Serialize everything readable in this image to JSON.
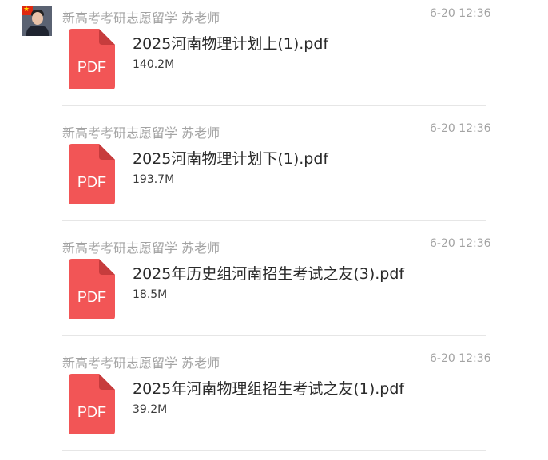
{
  "colors": {
    "pdf_icon": "#f25556",
    "pdf_icon_fold": "#c73c3d",
    "meta_text": "#a3a3a3",
    "divider": "#e6e6e6"
  },
  "avatar_icon": "user-avatar-with-china-flag",
  "messages": [
    {
      "sender": "新高考考研志愿留学 苏老师",
      "time": "6-20 12:36",
      "file_icon": "pdf-icon",
      "file_type": "PDF",
      "file_name": "2025河南物理计划上(1).pdf",
      "file_size": "140.2M"
    },
    {
      "sender": "新高考考研志愿留学 苏老师",
      "time": "6-20 12:36",
      "file_icon": "pdf-icon",
      "file_type": "PDF",
      "file_name": "2025河南物理计划下(1).pdf",
      "file_size": "193.7M"
    },
    {
      "sender": "新高考考研志愿留学 苏老师",
      "time": "6-20 12:36",
      "file_icon": "pdf-icon",
      "file_type": "PDF",
      "file_name": "2025年历史组河南招生考试之友(3).pdf",
      "file_size": "18.5M"
    },
    {
      "sender": "新高考考研志愿留学 苏老师",
      "time": "6-20 12:36",
      "file_icon": "pdf-icon",
      "file_type": "PDF",
      "file_name": "2025年河南物理组招生考试之友(1).pdf",
      "file_size": "39.2M"
    }
  ]
}
